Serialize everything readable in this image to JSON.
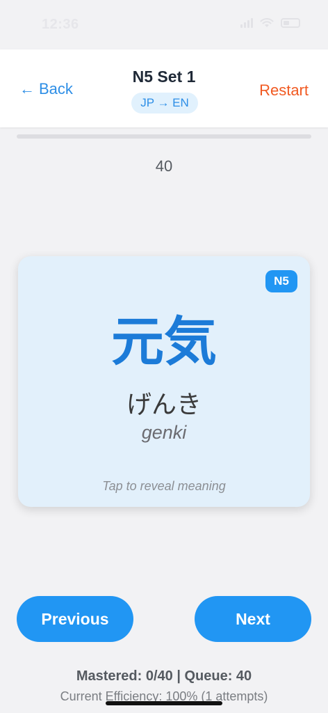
{
  "status_bar": {
    "time": "12:36"
  },
  "header": {
    "back_label": "Back",
    "title": "N5 Set 1",
    "direction": "JP → EN",
    "restart_label": "Restart"
  },
  "progress": {
    "fraction": 0.0
  },
  "card_count": "40",
  "card": {
    "level": "N5",
    "kanji": "元気",
    "kana": "げんき",
    "romaji": "genki",
    "hint": "Tap to reveal meaning"
  },
  "nav": {
    "previous_label": "Previous",
    "next_label": "Next"
  },
  "stats": {
    "summary": "Mastered: 0/40 | Queue: 40",
    "efficiency": "Current Efficiency: 100% (1 attempts)"
  },
  "colors": {
    "accent": "#2196f3",
    "link": "#2d8ee6",
    "danger": "#f15a22",
    "card_bg": "#e2f0fb"
  },
  "icons": {
    "back": "arrow-left-icon",
    "signal": "signal-icon",
    "wifi": "wifi-icon",
    "battery": "battery-icon"
  }
}
